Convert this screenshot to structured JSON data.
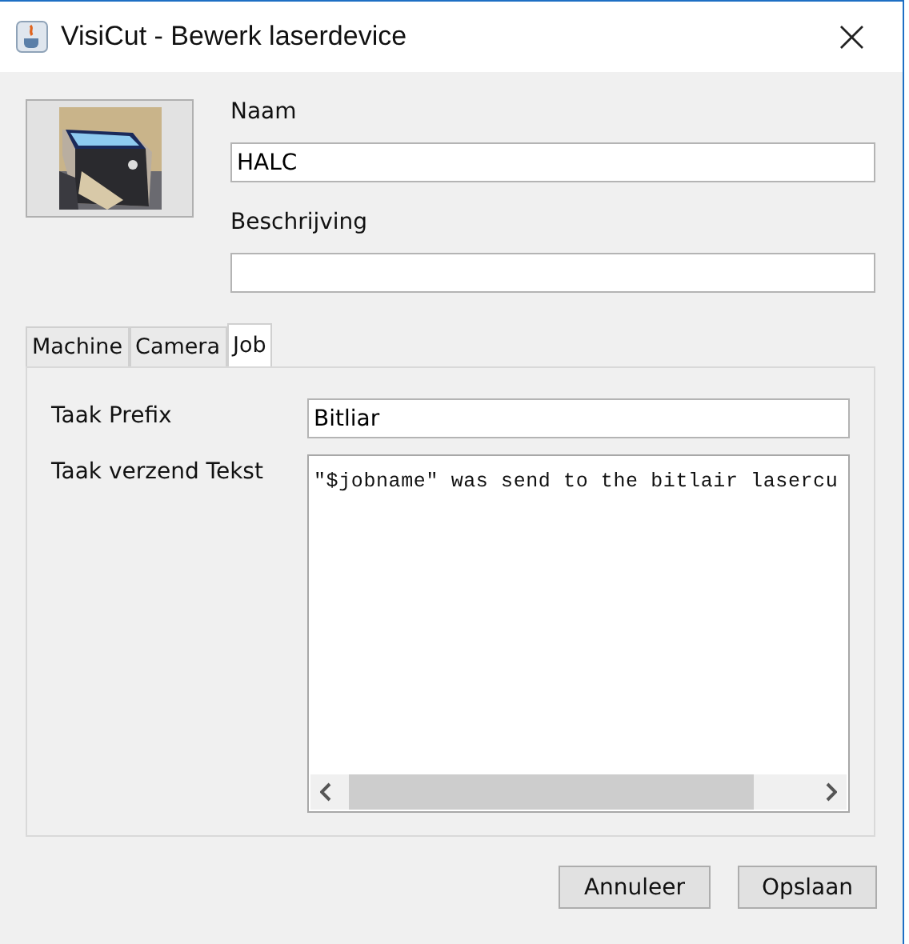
{
  "window": {
    "title": "VisiCut - Bewerk laserdevice",
    "close": "×"
  },
  "device": {
    "name_label": "Naam",
    "name_value": "HALC",
    "description_label": "Beschrijving"
  },
  "tabs": [
    {
      "label": "Machine",
      "selected": false
    },
    {
      "label": "Camera",
      "selected": false
    },
    {
      "label": "Job",
      "selected": true
    }
  ],
  "job": {
    "prefix_label": "Taak Prefix",
    "prefix_value": "Bitliar",
    "send_text_label": "Taak verzend Tekst",
    "send_text_value": "\"$jobname\" was send to the bitlair lasercu"
  },
  "buttons": [
    "Annuleer",
    "Opslaan"
  ]
}
